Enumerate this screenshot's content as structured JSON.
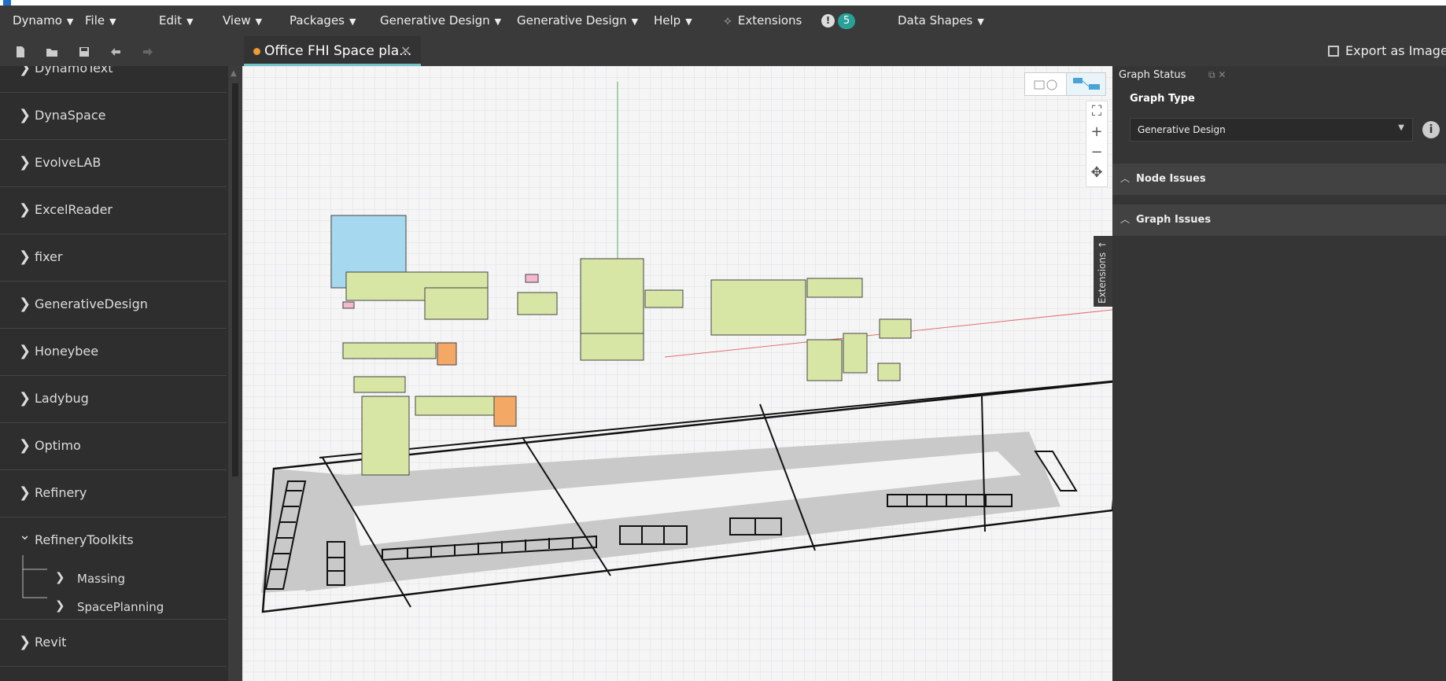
{
  "menubar": {
    "items": [
      {
        "label": "Dynamo",
        "caret": "▼"
      },
      {
        "label": "File",
        "caret": "▼"
      },
      {
        "label": "Edit",
        "caret": "▼"
      },
      {
        "label": "View",
        "caret": "▼"
      },
      {
        "label": "Packages",
        "caret": "▼"
      },
      {
        "label": "Generative Design",
        "caret": "▼"
      },
      {
        "label": "Generative Design",
        "caret": "▼"
      },
      {
        "label": "Help",
        "caret": "▼"
      },
      {
        "label": "Extensions",
        "caret": ""
      },
      {
        "label": "Data Shapes",
        "caret": "▼"
      }
    ],
    "notification_count": "5",
    "alert_glyph": "!"
  },
  "toolbar": {
    "icons": [
      "new-file-icon",
      "open-folder-icon",
      "save-icon",
      "undo-icon",
      "redo-icon"
    ]
  },
  "tab": {
    "title": "Office FHI Space pla...",
    "close": "✕"
  },
  "export": {
    "label": "Export as Image",
    "caret": "▼"
  },
  "sidebar": {
    "items": [
      {
        "label": "DynamoText",
        "chevron": "❯"
      },
      {
        "label": "DynaSpace",
        "chevron": "❯"
      },
      {
        "label": "EvolveLAB",
        "chevron": "❯"
      },
      {
        "label": "ExcelReader",
        "chevron": "❯"
      },
      {
        "label": "fixer",
        "chevron": "❯"
      },
      {
        "label": "GenerativeDesign",
        "chevron": "❯"
      },
      {
        "label": "Honeybee",
        "chevron": "❯"
      },
      {
        "label": "Ladybug",
        "chevron": "❯"
      },
      {
        "label": "Optimo",
        "chevron": "❯"
      },
      {
        "label": "Refinery",
        "chevron": "❯"
      },
      {
        "label": "RefineryToolkits",
        "chevron": "⌄"
      },
      {
        "label": "Revit",
        "chevron": "❯"
      }
    ],
    "subitems": [
      {
        "label": "Massing",
        "chevron": "❯"
      },
      {
        "label": "SpacePlanning",
        "chevron": "❯"
      }
    ]
  },
  "zoom": {
    "fit": "⛶",
    "plus": "+",
    "minus": "−",
    "pan": "✥"
  },
  "extensions_tab": {
    "label": "Extensions",
    "arrow": "←"
  },
  "panel": {
    "title": "Graph Status",
    "controls": "⧉  ✕",
    "graph_type_label": "Graph Type",
    "graph_type_value": "Generative Design",
    "select_arrow": "▼",
    "info_glyph": "i",
    "sections": [
      {
        "label": "Node Issues",
        "caret": "︿"
      },
      {
        "label": "Graph Issues",
        "caret": "︿"
      }
    ]
  },
  "colors": {
    "accent": "#6fc3c8",
    "badge": "#2aa198",
    "modified_dot": "#ef9a33",
    "node_group_green": "#d8e6a5",
    "node_group_blue": "#a6d8f0",
    "node_group_orange": "#f4a866",
    "floor_gray": "#c9c9c9"
  }
}
